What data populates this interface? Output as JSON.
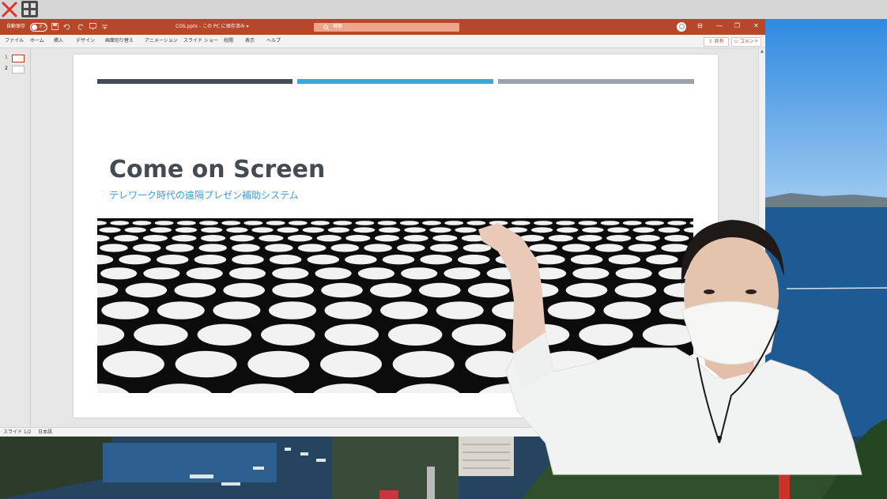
{
  "overlay": {
    "close_icon": "close-icon",
    "layout_icon": "grid-layout-icon"
  },
  "titlebar": {
    "autosave_label": "自動保存",
    "autosave_state": "オフ",
    "filename": "COS.pptx - この PC に保存済み ▾",
    "search_placeholder": "検索",
    "minimize": "—",
    "restore": "❐",
    "close": "✕",
    "ribbon_display": "⊟"
  },
  "ribbon": {
    "tabs": [
      "ファイル",
      "ホーム",
      "挿入",
      "デザイン",
      "画面切り替え",
      "アニメーション",
      "スライド ショー",
      "校閲",
      "表示",
      "ヘルプ"
    ],
    "share_label": "共有",
    "comment_label": "コメント"
  },
  "thumbnails": [
    {
      "number": "1",
      "active": true
    },
    {
      "number": "2",
      "active": false
    }
  ],
  "slide": {
    "title": "Come on Screen",
    "subtitle": "テレワーク時代の遠隔プレゼン補助システム",
    "bar_colors": [
      "#454b52",
      "#3aa7dc",
      "#9aa1a8"
    ]
  },
  "statusbar": {
    "slide_indicator": "スライド 1/2",
    "language": "日本語"
  },
  "colors": {
    "ppt_accent": "#b7472a",
    "subtitle": "#3a9fd4",
    "title": "#454b52"
  }
}
